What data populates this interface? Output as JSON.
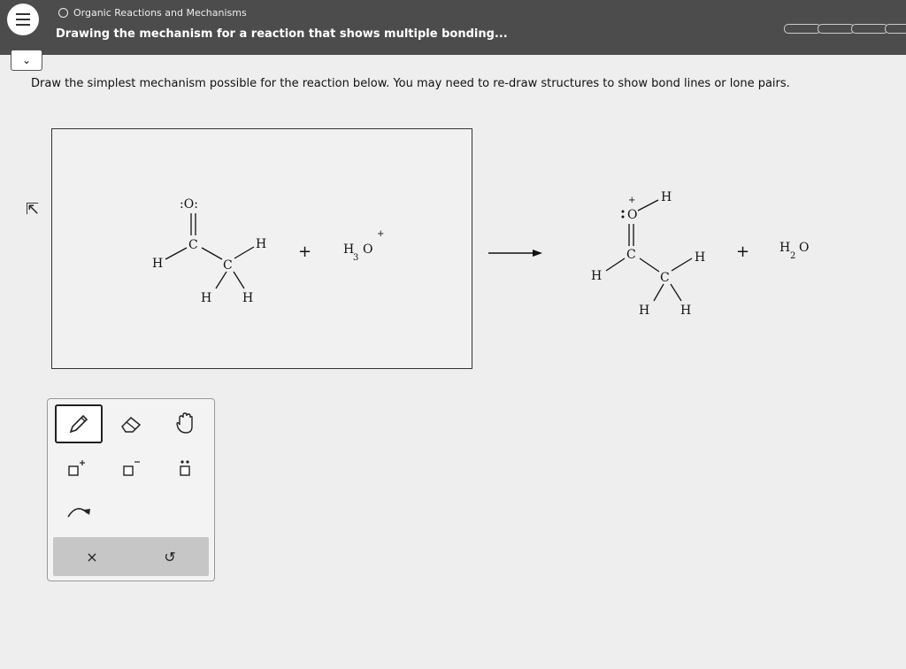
{
  "header": {
    "topic": "Organic Reactions and Mechanisms",
    "title": "Drawing the mechanism for a reaction that shows multiple bonding..."
  },
  "instructions": "Draw the simplest mechanism possible for the reaction below. You may need to re-draw structures to show bond lines or lone pairs.",
  "reaction": {
    "reactant": {
      "O": ":O:",
      "C1": "C",
      "C2": "C",
      "H_left": "H",
      "H_right": "H",
      "H_bottom1": "H",
      "H_bottom2": "H"
    },
    "plus1": "+",
    "reagent": {
      "main": "H",
      "sub": "3",
      "o": "O",
      "charge": "+"
    },
    "product": {
      "O": "O",
      "charge": "+",
      "H_top": "H",
      "C1": "C",
      "C2": "C",
      "H_left": "H",
      "H_right": "H",
      "H_bottom1": "H",
      "H_bottom2": "H"
    },
    "plus2": "+",
    "byproduct": {
      "main": "H",
      "sub": "2",
      "o": "O"
    }
  },
  "toolbox": {
    "icons": [
      "pencil-icon",
      "eraser-icon",
      "hand-icon",
      "positive-charge-icon",
      "negative-charge-icon",
      "lone-pair-icon",
      "curved-arrow-icon"
    ],
    "clear_label": "×",
    "undo_label": "↺"
  }
}
